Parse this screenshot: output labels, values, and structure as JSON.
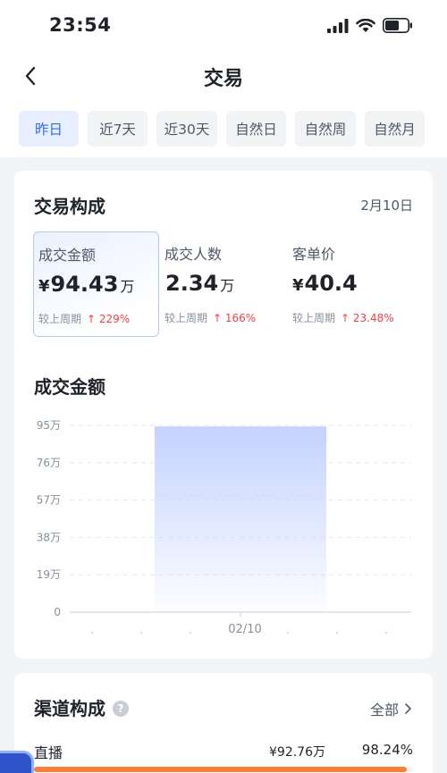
{
  "status_bar": {
    "time": "23:54"
  },
  "nav": {
    "title": "交易"
  },
  "tabs": [
    {
      "label": "昨日",
      "active": true
    },
    {
      "label": "近7天",
      "active": false
    },
    {
      "label": "近30天",
      "active": false
    },
    {
      "label": "自然日",
      "active": false
    },
    {
      "label": "自然周",
      "active": false
    },
    {
      "label": "自然月",
      "active": false
    }
  ],
  "composition": {
    "title": "交易构成",
    "date": "2月10日",
    "metrics": [
      {
        "label": "成交金额",
        "currency": "¥",
        "value": "94.43",
        "unit": "万",
        "compare_label": "较上周期",
        "change": "↑ 229%"
      },
      {
        "label": "成交人数",
        "currency": "",
        "value": "2.34",
        "unit": "万",
        "compare_label": "较上周期",
        "change": "↑ 166%"
      },
      {
        "label": "客单价",
        "currency": "¥",
        "value": "40.4",
        "unit": "",
        "compare_label": "较上周期",
        "change": "↑ 23.48%"
      }
    ]
  },
  "amount_chart": {
    "title": "成交金额",
    "y_ticks": [
      "95万",
      "76万",
      "57万",
      "38万",
      "19万",
      "0"
    ],
    "x_label": "02/10"
  },
  "chart_data": {
    "type": "bar",
    "title": "成交金额",
    "categories": [
      "02/10"
    ],
    "values": [
      94.43
    ],
    "ylim": [
      0,
      95
    ],
    "yticks": [
      0,
      19,
      38,
      57,
      76,
      95
    ],
    "grid": true
  },
  "channels": {
    "title": "渠道构成",
    "more_label": "全部",
    "items": [
      {
        "name": "直播",
        "amount": "¥92.76万",
        "percent": "98.24%",
        "share": 0.9824
      }
    ]
  },
  "colors": {
    "accent": "#2f6bff",
    "up": "#f53f3f",
    "bar_top": "#c3d2ff",
    "channel_bar": "#ff7d35"
  }
}
